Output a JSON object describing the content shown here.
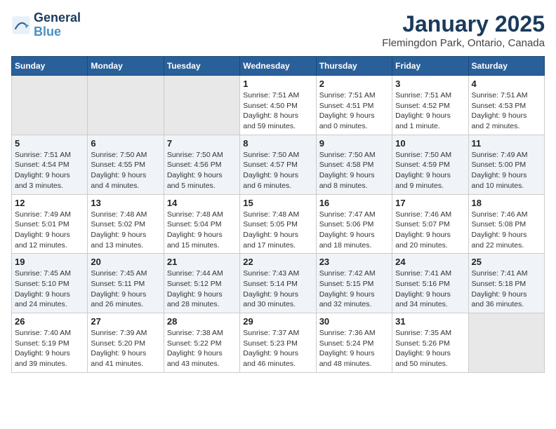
{
  "header": {
    "logo_line1": "General",
    "logo_line2": "Blue",
    "title": "January 2025",
    "subtitle": "Flemingdon Park, Ontario, Canada"
  },
  "weekdays": [
    "Sunday",
    "Monday",
    "Tuesday",
    "Wednesday",
    "Thursday",
    "Friday",
    "Saturday"
  ],
  "weeks": [
    [
      {
        "day": "",
        "info": ""
      },
      {
        "day": "",
        "info": ""
      },
      {
        "day": "",
        "info": ""
      },
      {
        "day": "1",
        "info": "Sunrise: 7:51 AM\nSunset: 4:50 PM\nDaylight: 8 hours\nand 59 minutes."
      },
      {
        "day": "2",
        "info": "Sunrise: 7:51 AM\nSunset: 4:51 PM\nDaylight: 9 hours\nand 0 minutes."
      },
      {
        "day": "3",
        "info": "Sunrise: 7:51 AM\nSunset: 4:52 PM\nDaylight: 9 hours\nand 1 minute."
      },
      {
        "day": "4",
        "info": "Sunrise: 7:51 AM\nSunset: 4:53 PM\nDaylight: 9 hours\nand 2 minutes."
      }
    ],
    [
      {
        "day": "5",
        "info": "Sunrise: 7:51 AM\nSunset: 4:54 PM\nDaylight: 9 hours\nand 3 minutes."
      },
      {
        "day": "6",
        "info": "Sunrise: 7:50 AM\nSunset: 4:55 PM\nDaylight: 9 hours\nand 4 minutes."
      },
      {
        "day": "7",
        "info": "Sunrise: 7:50 AM\nSunset: 4:56 PM\nDaylight: 9 hours\nand 5 minutes."
      },
      {
        "day": "8",
        "info": "Sunrise: 7:50 AM\nSunset: 4:57 PM\nDaylight: 9 hours\nand 6 minutes."
      },
      {
        "day": "9",
        "info": "Sunrise: 7:50 AM\nSunset: 4:58 PM\nDaylight: 9 hours\nand 8 minutes."
      },
      {
        "day": "10",
        "info": "Sunrise: 7:50 AM\nSunset: 4:59 PM\nDaylight: 9 hours\nand 9 minutes."
      },
      {
        "day": "11",
        "info": "Sunrise: 7:49 AM\nSunset: 5:00 PM\nDaylight: 9 hours\nand 10 minutes."
      }
    ],
    [
      {
        "day": "12",
        "info": "Sunrise: 7:49 AM\nSunset: 5:01 PM\nDaylight: 9 hours\nand 12 minutes."
      },
      {
        "day": "13",
        "info": "Sunrise: 7:48 AM\nSunset: 5:02 PM\nDaylight: 9 hours\nand 13 minutes."
      },
      {
        "day": "14",
        "info": "Sunrise: 7:48 AM\nSunset: 5:04 PM\nDaylight: 9 hours\nand 15 minutes."
      },
      {
        "day": "15",
        "info": "Sunrise: 7:48 AM\nSunset: 5:05 PM\nDaylight: 9 hours\nand 17 minutes."
      },
      {
        "day": "16",
        "info": "Sunrise: 7:47 AM\nSunset: 5:06 PM\nDaylight: 9 hours\nand 18 minutes."
      },
      {
        "day": "17",
        "info": "Sunrise: 7:46 AM\nSunset: 5:07 PM\nDaylight: 9 hours\nand 20 minutes."
      },
      {
        "day": "18",
        "info": "Sunrise: 7:46 AM\nSunset: 5:08 PM\nDaylight: 9 hours\nand 22 minutes."
      }
    ],
    [
      {
        "day": "19",
        "info": "Sunrise: 7:45 AM\nSunset: 5:10 PM\nDaylight: 9 hours\nand 24 minutes."
      },
      {
        "day": "20",
        "info": "Sunrise: 7:45 AM\nSunset: 5:11 PM\nDaylight: 9 hours\nand 26 minutes."
      },
      {
        "day": "21",
        "info": "Sunrise: 7:44 AM\nSunset: 5:12 PM\nDaylight: 9 hours\nand 28 minutes."
      },
      {
        "day": "22",
        "info": "Sunrise: 7:43 AM\nSunset: 5:14 PM\nDaylight: 9 hours\nand 30 minutes."
      },
      {
        "day": "23",
        "info": "Sunrise: 7:42 AM\nSunset: 5:15 PM\nDaylight: 9 hours\nand 32 minutes."
      },
      {
        "day": "24",
        "info": "Sunrise: 7:41 AM\nSunset: 5:16 PM\nDaylight: 9 hours\nand 34 minutes."
      },
      {
        "day": "25",
        "info": "Sunrise: 7:41 AM\nSunset: 5:18 PM\nDaylight: 9 hours\nand 36 minutes."
      }
    ],
    [
      {
        "day": "26",
        "info": "Sunrise: 7:40 AM\nSunset: 5:19 PM\nDaylight: 9 hours\nand 39 minutes."
      },
      {
        "day": "27",
        "info": "Sunrise: 7:39 AM\nSunset: 5:20 PM\nDaylight: 9 hours\nand 41 minutes."
      },
      {
        "day": "28",
        "info": "Sunrise: 7:38 AM\nSunset: 5:22 PM\nDaylight: 9 hours\nand 43 minutes."
      },
      {
        "day": "29",
        "info": "Sunrise: 7:37 AM\nSunset: 5:23 PM\nDaylight: 9 hours\nand 46 minutes."
      },
      {
        "day": "30",
        "info": "Sunrise: 7:36 AM\nSunset: 5:24 PM\nDaylight: 9 hours\nand 48 minutes."
      },
      {
        "day": "31",
        "info": "Sunrise: 7:35 AM\nSunset: 5:26 PM\nDaylight: 9 hours\nand 50 minutes."
      },
      {
        "day": "",
        "info": ""
      }
    ]
  ]
}
